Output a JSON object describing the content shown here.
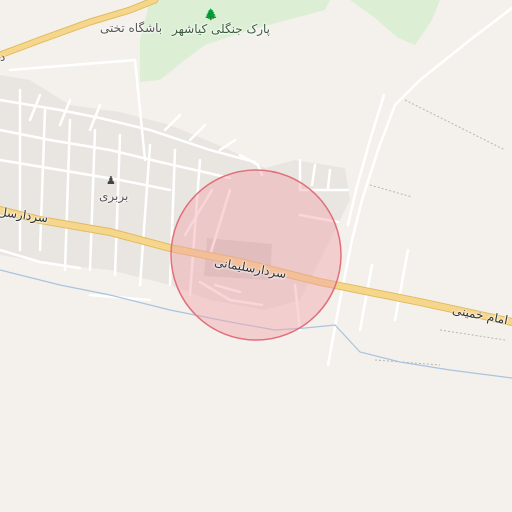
{
  "labels": {
    "park": "پارک جنگلی کیاشهر",
    "club": "باشگاه تختی",
    "village": "بربری",
    "road_sardar": "سردارسلیمانی",
    "road_sardar_left": "سردارسل",
    "road_imam": "امام خمینی",
    "edge_fragment": "د"
  },
  "icons": {
    "park": "tree-icon",
    "village": "settlement-icon"
  },
  "colors": {
    "land": "#f4f1ec",
    "park": "#dcefd5",
    "main_road": "#f5d68a",
    "built_up": "#e9e6e1",
    "minor_road": "#ffffff",
    "water": "#a9c3e0",
    "highlight_fill": "#f2a3ab",
    "highlight_stroke": "#e0707c"
  }
}
